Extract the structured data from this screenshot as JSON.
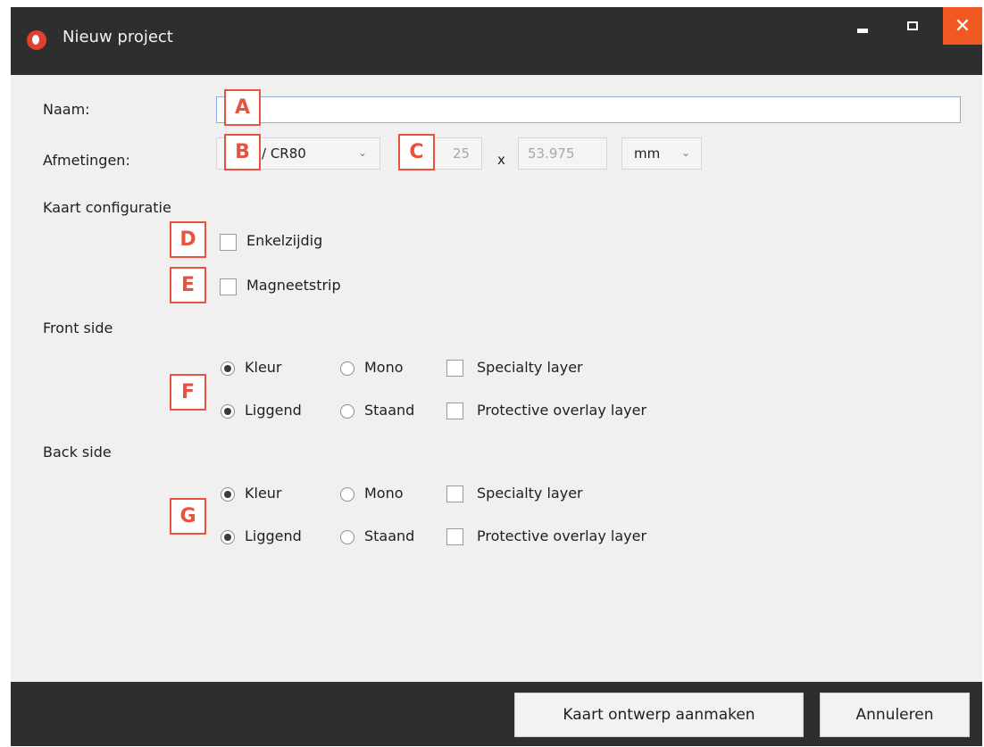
{
  "window": {
    "title": "Nieuw project"
  },
  "form": {
    "name_label": "Naam:",
    "name_value": "",
    "dimensions_label": "Afmetingen:",
    "size_select": "/ CR80",
    "width_value": "25",
    "times": "x",
    "height_value": "53.975",
    "unit_select": "mm",
    "card_config_label": "Kaart configuratie",
    "single_sided_label": "Enkelzijdig",
    "single_sided_checked": false,
    "mag_stripe_label": "Magneetstrip",
    "mag_stripe_checked": false
  },
  "front": {
    "heading": "Front side",
    "color_label": "Kleur",
    "mono_label": "Mono",
    "specialty_label": "Specialty layer",
    "landscape_label": "Liggend",
    "portrait_label": "Staand",
    "overlay_label": "Protective overlay layer",
    "color_mode": "Kleur",
    "orientation": "Liggend"
  },
  "back": {
    "heading": "Back side",
    "color_label": "Kleur",
    "mono_label": "Mono",
    "specialty_label": "Specialty layer",
    "landscape_label": "Liggend",
    "portrait_label": "Staand",
    "overlay_label": "Protective overlay layer",
    "color_mode": "Kleur",
    "orientation": "Liggend"
  },
  "markers": {
    "a": "A",
    "b": "B",
    "c": "C",
    "d": "D",
    "e": "E",
    "f": "F",
    "g": "G"
  },
  "footer": {
    "create_label": "Kaart ontwerp aanmaken",
    "cancel_label": "Annuleren"
  },
  "colors": {
    "accent": "#e8533f",
    "titlebar": "#2e2e2e",
    "close": "#f05a22"
  }
}
